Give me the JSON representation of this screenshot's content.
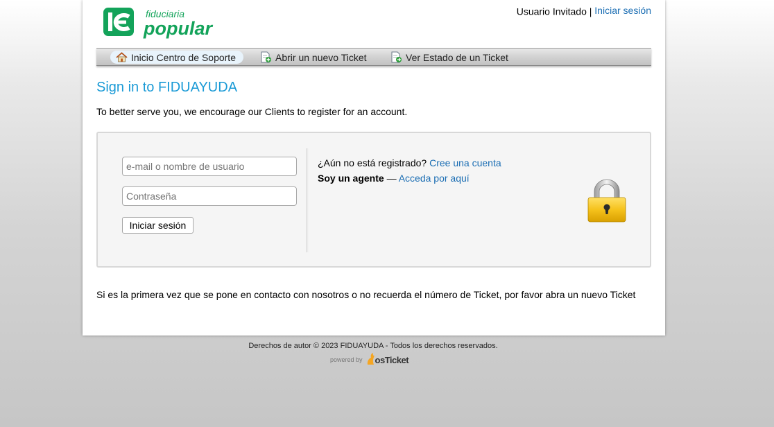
{
  "brand": {
    "line1": "fiduciaria",
    "line2": "popular",
    "color": "#13a35a"
  },
  "userbar": {
    "guest_label": "Usuario Invitado",
    "separator": "|",
    "signin_link": "Iniciar sesión"
  },
  "nav": {
    "items": [
      {
        "label": "Inicio Centro de Soporte",
        "icon": "home-icon",
        "active": true
      },
      {
        "label": "Abrir un nuevo Ticket",
        "icon": "new-ticket-icon",
        "active": false
      },
      {
        "label": "Ver Estado de un Ticket",
        "icon": "ticket-status-icon",
        "active": false
      }
    ]
  },
  "page": {
    "title": "Sign in to FIDUAYUDA",
    "intro": "To better serve you, we encourage our Clients to register for an account."
  },
  "login": {
    "username_placeholder": "e-mail o nombre de usuario",
    "password_placeholder": "Contraseña",
    "submit_label": "Iniciar sesión",
    "register_prompt": "¿Aún no está registrado?",
    "register_link": "Cree una cuenta",
    "agent_label": "Soy un agente",
    "agent_dash": "—",
    "agent_link": "Acceda por aquí",
    "lock_icon": "padlock-icon"
  },
  "footer_note": "Si es la primera vez que se pone en contacto con nosotros o no recuerda el número de Ticket, por favor abra un nuevo Ticket",
  "footer": {
    "copyright": "Derechos de autor © 2023 FIDUAYUDA - Todos los derechos reservados.",
    "powered_by": "powered by",
    "product": "osTicket"
  },
  "colors": {
    "link": "#1a6db3",
    "title": "#1a9ad6",
    "accent_orange": "#f5a623"
  }
}
